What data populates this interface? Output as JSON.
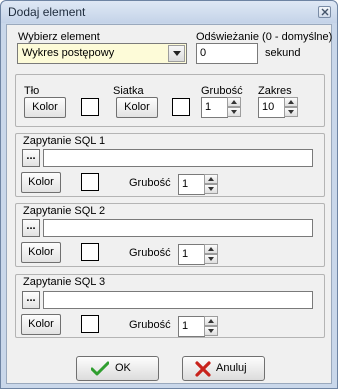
{
  "window": {
    "title": "Dodaj element"
  },
  "element": {
    "label": "Wybierz element",
    "selected": "Wykres postępowy"
  },
  "refresh": {
    "label": "Odświeżanie (0 - domyślne)",
    "value": "0",
    "unit": "sekund"
  },
  "appearance": {
    "background_label": "Tło",
    "background_button": "Kolor",
    "grid_label": "Siatka",
    "grid_button": "Kolor",
    "thickness_label": "Grubość",
    "thickness_value": "1",
    "range_label": "Zakres",
    "range_value": "10"
  },
  "queries": [
    {
      "label": "Zapytanie SQL 1",
      "browse": "...",
      "query": "",
      "color_button": "Kolor",
      "thickness_label": "Grubość",
      "thickness_value": "1"
    },
    {
      "label": "Zapytanie SQL 2",
      "browse": "...",
      "query": "",
      "color_button": "Kolor",
      "thickness_label": "Grubość",
      "thickness_value": "1"
    },
    {
      "label": "Zapytanie SQL 3",
      "browse": "...",
      "query": "",
      "color_button": "Kolor",
      "thickness_label": "Grubość",
      "thickness_value": "1"
    }
  ],
  "buttons": {
    "ok": "OK",
    "cancel": "Anuluj"
  },
  "colors": {
    "ok_check": "#2f9e2f",
    "cancel_x": "#c8231c",
    "select_bg": "#fdfbd8"
  }
}
